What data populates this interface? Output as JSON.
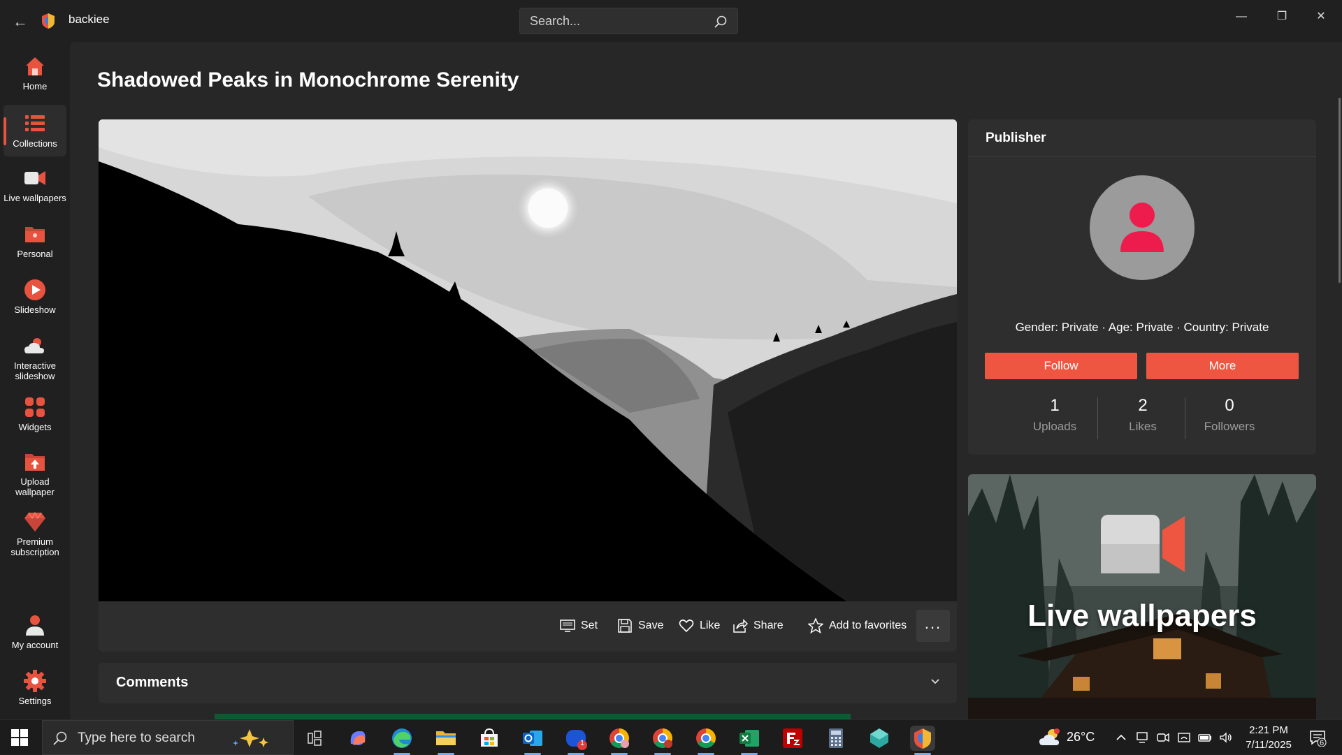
{
  "app": {
    "title": "backiee",
    "brand_color": "#ef5641"
  },
  "search": {
    "placeholder": "Search..."
  },
  "sidebar": {
    "items": [
      {
        "label": "Home",
        "icon": "home-icon"
      },
      {
        "label": "Collections",
        "icon": "collections-icon",
        "active": true
      },
      {
        "label": "Live wallpapers",
        "icon": "video-camera-icon"
      },
      {
        "label": "Personal",
        "icon": "personal-folder-icon"
      },
      {
        "label": "Slideshow",
        "icon": "play-icon"
      },
      {
        "label": "Interactive slideshow",
        "icon": "weather-cloud-icon"
      },
      {
        "label": "Widgets",
        "icon": "widgets-icon"
      },
      {
        "label": "Upload wallpaper",
        "icon": "upload-icon"
      },
      {
        "label": "Premium subscription",
        "icon": "diamond-icon"
      },
      {
        "label": "My account",
        "icon": "user-icon"
      },
      {
        "label": "Settings",
        "icon": "gear-icon"
      }
    ]
  },
  "wallpaper": {
    "title": "Shadowed Peaks in Monochrome Serenity",
    "actions": {
      "set": "Set",
      "save": "Save",
      "like": "Like",
      "share": "Share",
      "favorites": "Add to favorites",
      "more": "..."
    }
  },
  "comments": {
    "title": "Comments"
  },
  "publisher": {
    "title": "Publisher",
    "info": "Gender: Private · Age: Private · Country: Private",
    "follow_label": "Follow",
    "more_label": "More",
    "stats": [
      {
        "value": "1",
        "label": "Uploads"
      },
      {
        "value": "2",
        "label": "Likes"
      },
      {
        "value": "0",
        "label": "Followers"
      }
    ]
  },
  "promo": {
    "text": "Live wallpapers"
  },
  "taskbar": {
    "search_text": "Type here to search",
    "temperature": "26°C",
    "time": "2:21 PM",
    "date": "7/11/2025",
    "notification_count": "6",
    "outlook_badge": "1"
  }
}
